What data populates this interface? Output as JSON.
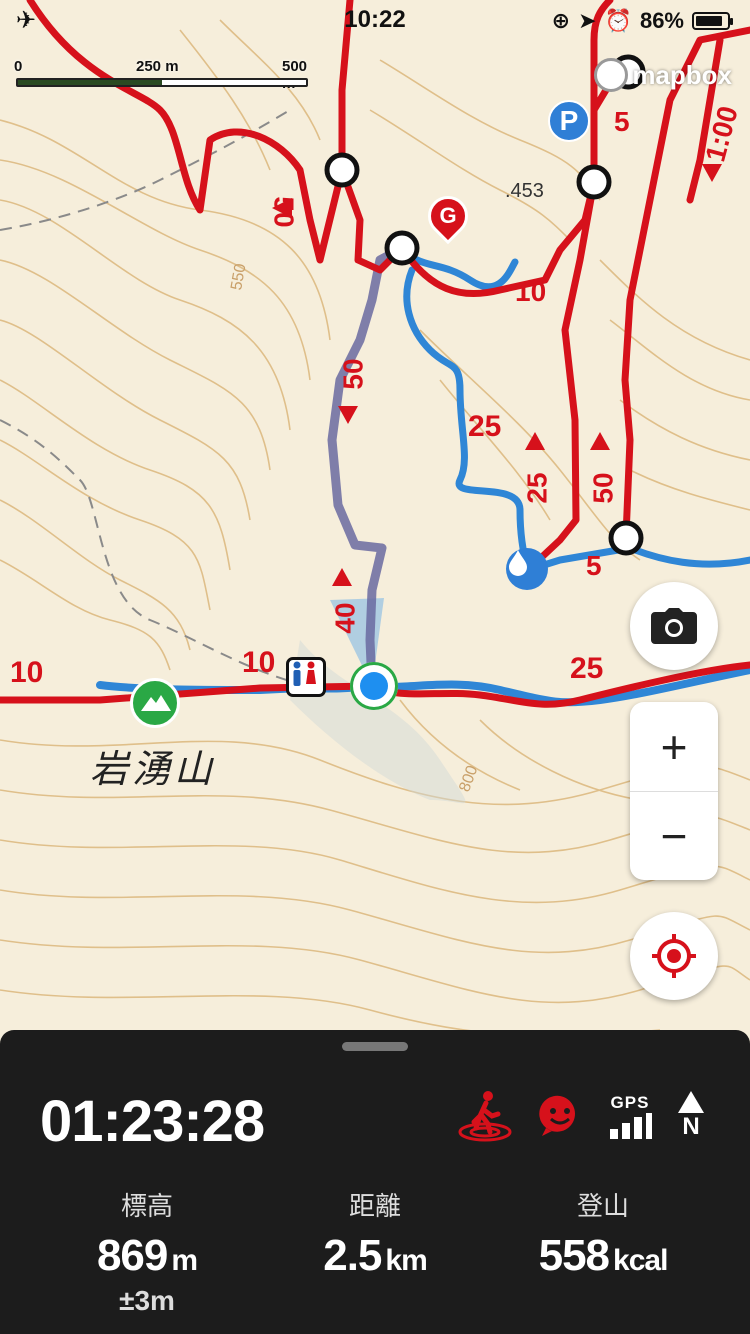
{
  "status_bar": {
    "time": "10:22",
    "battery": "86%",
    "battery_level": 0.86
  },
  "scale": {
    "labels": [
      "0",
      "250 m",
      "500 m"
    ]
  },
  "map": {
    "attribution": "mapbox",
    "mountain_name": "岩湧山",
    "spot_height": ".453",
    "contour_labels": [
      "550",
      "800"
    ],
    "route_times": [
      "50",
      "10",
      "50",
      "25",
      "25",
      "50",
      "5",
      "5",
      "40",
      "10",
      "10",
      "25",
      "1:00"
    ],
    "markers": {
      "goal": "G",
      "parking": "P"
    },
    "colors": {
      "route_red": "#d6111b",
      "track_blue": "#2f86d6",
      "contour": "#d8b37a"
    }
  },
  "controls": {
    "zoom_in": "+",
    "zoom_out": "−"
  },
  "panel": {
    "elapsed": "01:23:28",
    "gps_label": "GPS",
    "compass_label": "N",
    "stats": [
      {
        "label": "標高",
        "value": "869",
        "unit": "m",
        "sub": "±3m"
      },
      {
        "label": "距離",
        "value": "2.5",
        "unit": "km",
        "sub": ""
      },
      {
        "label": "登山",
        "value": "558",
        "unit": "kcal",
        "sub": ""
      }
    ]
  }
}
